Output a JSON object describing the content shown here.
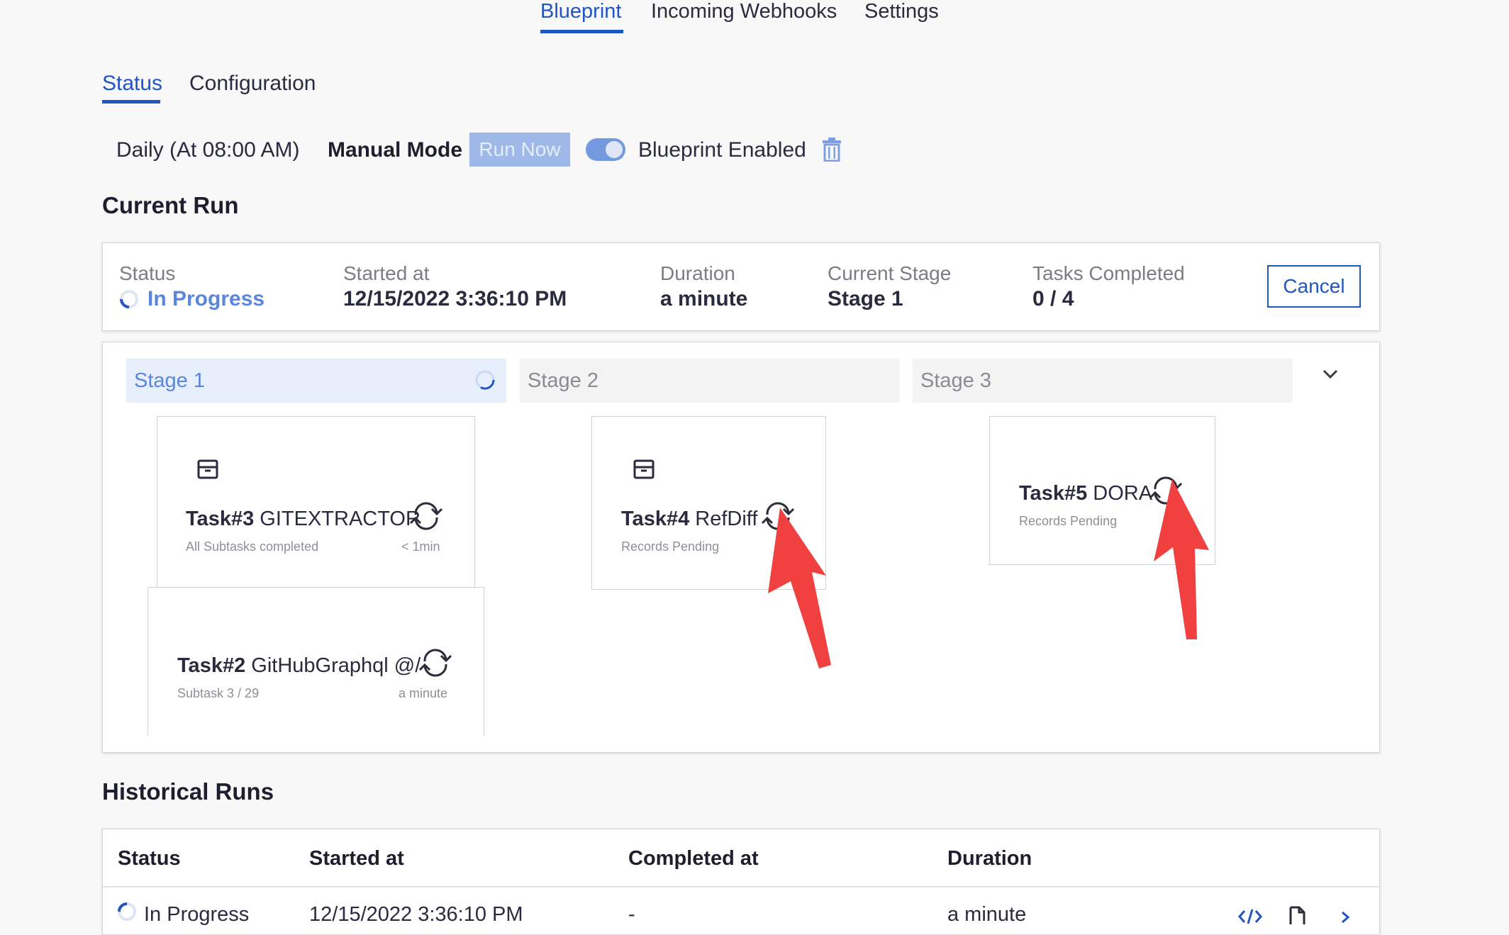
{
  "top_nav": {
    "tabs": [
      "Blueprint",
      "Incoming Webhooks",
      "Settings"
    ],
    "active": "Blueprint"
  },
  "sub_tabs": {
    "tabs": [
      "Status",
      "Configuration"
    ],
    "active": "Status"
  },
  "schedule": {
    "frequency": "Daily (At 08:00 AM)",
    "mode": "Manual Mode",
    "run_now": "Run Now",
    "toggle_on": true,
    "enabled_label": "Blueprint Enabled"
  },
  "current_run": {
    "title": "Current Run",
    "status_label": "Status",
    "status_value": "In Progress",
    "started_label": "Started at",
    "started_value": "12/15/2022 3:36:10 PM",
    "duration_label": "Duration",
    "duration_value": "a minute",
    "stage_label": "Current Stage",
    "stage_value": "Stage 1",
    "tasks_label": "Tasks Completed",
    "tasks_value": "0 / 4",
    "cancel": "Cancel"
  },
  "stages": [
    {
      "name": "Stage 1",
      "tasks": [
        {
          "id": "Task#3",
          "name": "GITEXTRACTOR",
          "status": "All Subtasks completed",
          "time": "< 1min"
        },
        {
          "id": "Task#2",
          "name": "GitHubGraphql @/",
          "status": "Subtask 3 / 29",
          "time": "a minute"
        }
      ]
    },
    {
      "name": "Stage 2",
      "tasks": [
        {
          "id": "Task#4",
          "name": "RefDiff",
          "status": "Records Pending"
        }
      ]
    },
    {
      "name": "Stage 3",
      "tasks": [
        {
          "id": "Task#5",
          "name": "DORA",
          "status": "Records Pending"
        }
      ]
    }
  ],
  "historical": {
    "title": "Historical Runs",
    "headers": [
      "Status",
      "Started at",
      "Completed at",
      "Duration"
    ],
    "rows": [
      {
        "status": "In Progress",
        "started": "12/15/2022 3:36:10 PM",
        "completed": "-",
        "duration": "a minute"
      }
    ]
  },
  "colors": {
    "accent": "#2155c2",
    "annotation_arrow": "#f04040"
  }
}
